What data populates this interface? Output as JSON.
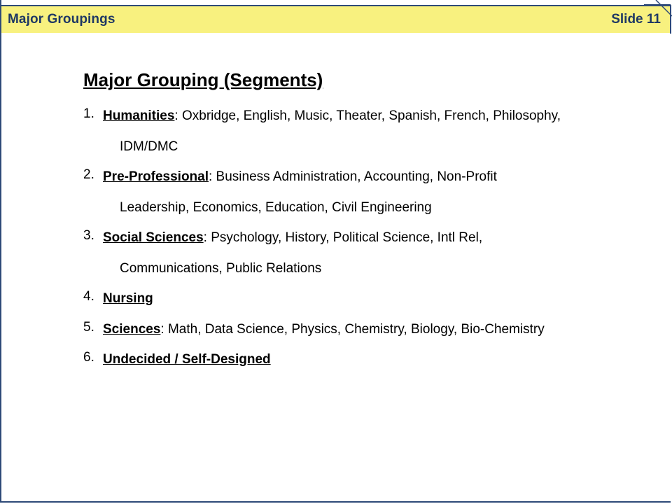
{
  "header": {
    "title": "Major Groupings",
    "slide_label": "Slide 11"
  },
  "heading": "Major Grouping (Segments)",
  "items": [
    {
      "num": "1.",
      "category": "Humanities",
      "line1": ": Oxbridge, English, Music, Theater, Spanish, French, Philosophy,",
      "line2": "IDM/DMC"
    },
    {
      "num": "2.",
      "category": "Pre-Professional",
      "line1": ": Business Administration, Accounting, Non-Profit",
      "line2": "Leadership, Economics, Education, Civil Engineering"
    },
    {
      "num": "3.",
      "category": "Social Sciences",
      "line1": ":  Psychology, History, Political Science, Intl Rel,",
      "line2": "Communications, Public Relations"
    },
    {
      "num": "4.",
      "category": "Nursing",
      "line1": ""
    },
    {
      "num": "5.",
      "category": "Sciences",
      "line1": ": Math, Data Science, Physics, Chemistry, Biology, Bio-Chemistry"
    },
    {
      "num": "6.",
      "category": "Undecided / Self-Designed",
      "line1": ""
    }
  ],
  "colors": {
    "header_bg": "#f8f17f",
    "header_text": "#1f3864",
    "frame": "#2e4a78"
  }
}
